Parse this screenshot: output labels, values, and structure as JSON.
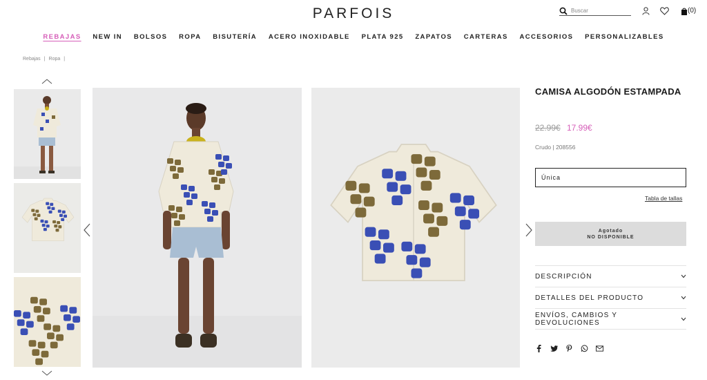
{
  "header": {
    "logo": "PARFOIS",
    "search_placeholder": "Buscar",
    "cart_count": "(0)"
  },
  "nav": [
    "REBAJAS",
    "NEW IN",
    "BOLSOS",
    "ROPA",
    "BISUTERÍA",
    "ACERO INOXIDABLE",
    "PLATA 925",
    "ZAPATOS",
    "CARTERAS",
    "ACCESORIOS",
    "PERSONALIZABLES"
  ],
  "breadcrumb": [
    "Rebajas",
    "|",
    "Ropa",
    "|"
  ],
  "product": {
    "title": "CAMISA ALGODÓN ESTAMPADA",
    "old_price": "22.99€",
    "new_price": "17.99€",
    "ref": "Crudo | 208556",
    "size": "Única",
    "size_table": "Tabla de tallas",
    "sold_out_line1": "Agotado",
    "sold_out_line2": "NO DISPONIBLE"
  },
  "accordion": [
    "DESCRIPCIÓN",
    "DETALLES DEL PRODUCTO",
    "ENVÍOS, CAMBIOS Y DEVOLUCIONES"
  ],
  "colors": {
    "accent_pink": "#d65fb9",
    "sold_out_bg": "#dcdcdc"
  },
  "icons": [
    "search-icon",
    "user-icon",
    "heart-icon",
    "bag-icon",
    "facebook-icon",
    "twitter-icon",
    "pinterest-icon",
    "whatsapp-icon",
    "mail-icon"
  ]
}
